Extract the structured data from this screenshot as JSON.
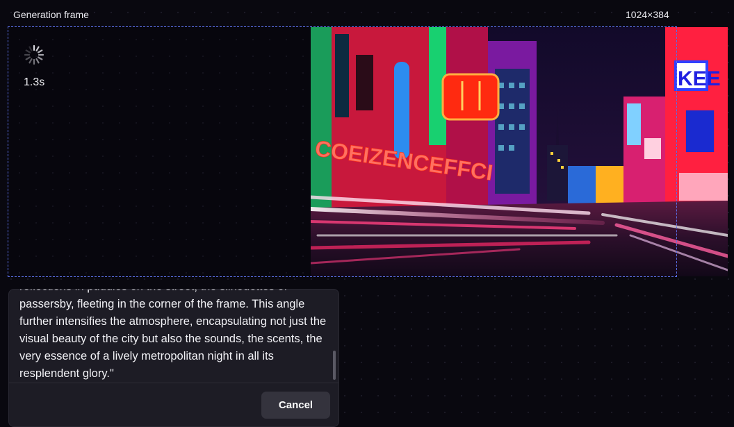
{
  "frame": {
    "label": "Generation frame",
    "size": "1024×384"
  },
  "generation": {
    "elapsed": "1.3s",
    "spinner_icon": "loading-spinner-icon"
  },
  "image": {
    "sign_text_left": "COEIZENCEFFCI",
    "sign_text_right": "KEE"
  },
  "prompt": {
    "text": "reflections in puddles on the street, the silhouettes of passersby, fleeting in the corner of the frame. This angle further intensifies the atmosphere, encapsulating not just the visual beauty of the city but also the sounds, the scents, the very essence of a lively metropolitan night in all its resplendent glory.\""
  },
  "actions": {
    "cancel_label": "Cancel"
  },
  "colors": {
    "frame_border": "#5b6fe8",
    "background": "#09080f",
    "panel": "#1d1c25",
    "button": "#34333d"
  }
}
